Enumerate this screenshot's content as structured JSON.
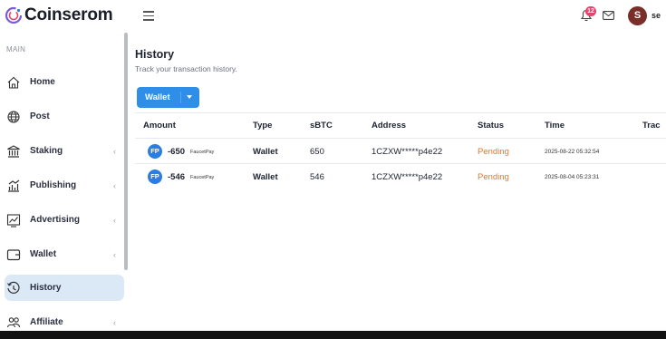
{
  "brand": {
    "name": "Coinserom",
    "accent": "#2f8fe8",
    "logo_colors": [
      "#e0466e",
      "#7a5bd6",
      "#2a7de1"
    ]
  },
  "header": {
    "notifications_count": "12",
    "avatar_initial": "S",
    "user_name_partial": "se"
  },
  "sidebar": {
    "section": "MAIN",
    "items": [
      {
        "label": "Home",
        "icon": "home-icon",
        "has_submenu": false,
        "active": false
      },
      {
        "label": "Post",
        "icon": "globe-icon",
        "has_submenu": false,
        "active": false
      },
      {
        "label": "Staking",
        "icon": "bank-icon",
        "has_submenu": true,
        "active": false
      },
      {
        "label": "Publishing",
        "icon": "bar-chart-icon",
        "has_submenu": true,
        "active": false
      },
      {
        "label": "Advertising",
        "icon": "line-chart-icon",
        "has_submenu": true,
        "active": false
      },
      {
        "label": "Wallet",
        "icon": "wallet-icon",
        "has_submenu": true,
        "active": false
      },
      {
        "label": "History",
        "icon": "history-icon",
        "has_submenu": false,
        "active": true
      },
      {
        "label": "Affiliate",
        "icon": "users-icon",
        "has_submenu": true,
        "active": false
      }
    ],
    "chevron": "‹"
  },
  "main": {
    "title": "History",
    "subtitle": "Track your transaction history.",
    "filter_button": "Wallet",
    "table": {
      "columns": [
        "Amount",
        "Type",
        "sBTC",
        "Address",
        "Status",
        "Time",
        "Trac"
      ],
      "rows": [
        {
          "badge": "FP",
          "amount": "-650",
          "source": "FaucetPay",
          "type": "Wallet",
          "sbtc": "650",
          "address": "1CZXW*****p4e22",
          "status": "Pending",
          "time": "2025-08-22 05:32:54"
        },
        {
          "badge": "FP",
          "amount": "-546",
          "source": "FaucetPay",
          "type": "Wallet",
          "sbtc": "546",
          "address": "1CZXW*****p4e22",
          "status": "Pending",
          "time": "2025-08-04 05:23:31"
        }
      ]
    }
  }
}
